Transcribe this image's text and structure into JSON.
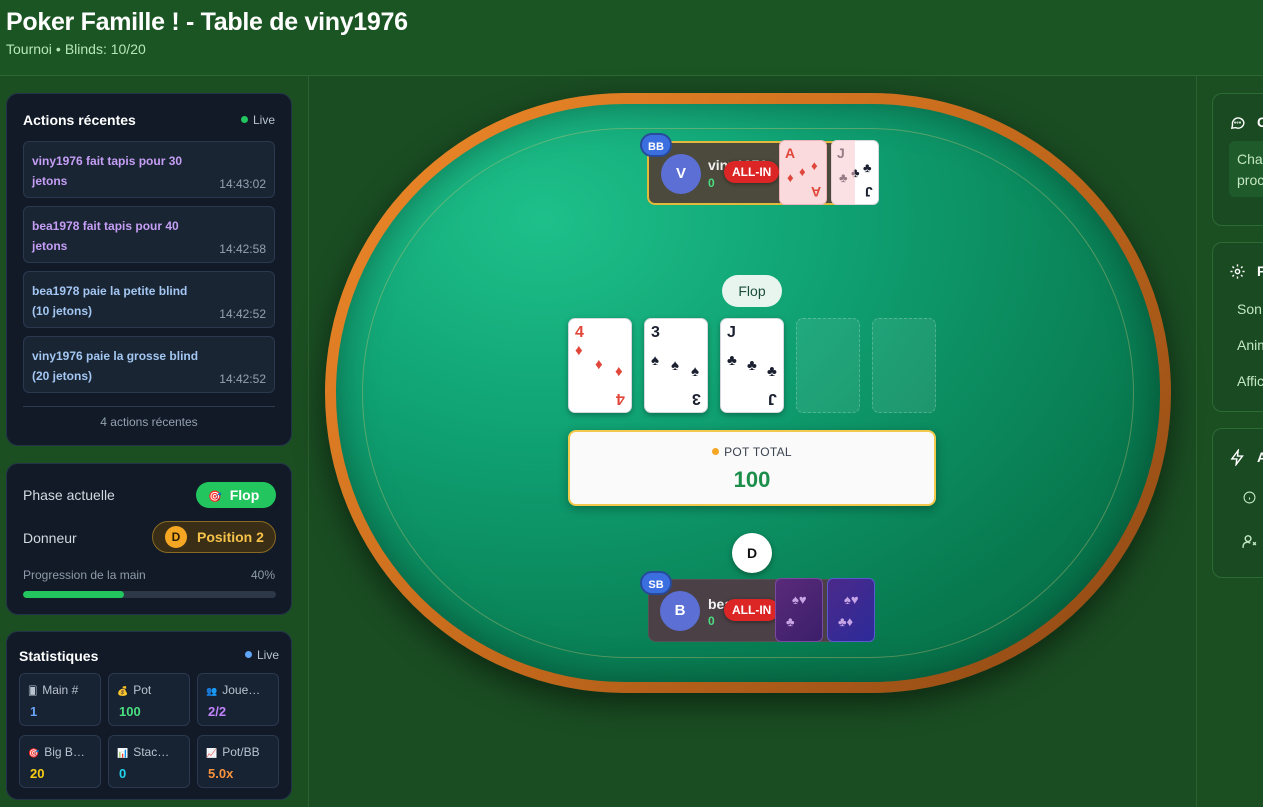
{
  "header": {
    "title": "Poker Famille ! - Table de viny1976",
    "mode": "Tournoi",
    "separator": "•",
    "blinds": "Blinds: 10/20"
  },
  "actions": {
    "title": "Actions récentes",
    "live_label": "Live",
    "items": [
      {
        "text": "viny1976 fait tapis pour 30 jetons",
        "time": "14:43:02"
      },
      {
        "text": "bea1978 fait tapis pour 40 jetons",
        "time": "14:42:58"
      },
      {
        "text": "bea1978 paie la petite blind (10 jetons)",
        "time": "14:42:52"
      },
      {
        "text": "viny1976 paie la grosse blind (20 jetons)",
        "time": "14:42:52"
      }
    ],
    "count_label": "4 actions récentes"
  },
  "phase": {
    "phase_label": "Phase actuelle",
    "phase_value": "Flop",
    "phase_icon": "target-icon",
    "dealer_label": "Donneur",
    "dealer_badge": "D",
    "dealer_value": "Position 2",
    "progress_label": "Progression de la main",
    "progress_text": "40%",
    "progress_fraction": 0.4
  },
  "stats": {
    "title": "Statistiques",
    "live_label": "Live",
    "items": [
      {
        "label": "Main #",
        "value": "1",
        "icon": "card-icon",
        "color": "#6aa5f7"
      },
      {
        "label": "Pot",
        "value": "100",
        "icon": "moneybag-icon",
        "color": "#4ade80"
      },
      {
        "label": "Joue…",
        "value": "2/2",
        "icon": "players-icon",
        "color": "#c084fc"
      },
      {
        "label": "Big B…",
        "value": "20",
        "icon": "target-icon",
        "color": "#facc15"
      },
      {
        "label": "Stac…",
        "value": "0",
        "icon": "chart-icon",
        "color": "#22d3ee"
      },
      {
        "label": "Pot/BB",
        "value": "5.0x",
        "icon": "trend-icon",
        "color": "#fb923c"
      }
    ]
  },
  "table": {
    "phase_label": "Flop",
    "community_cards": [
      {
        "rank": "4",
        "suit": "♦",
        "color": "red"
      },
      {
        "rank": "3",
        "suit": "♠",
        "color": "black"
      },
      {
        "rank": "J",
        "suit": "♣",
        "color": "black"
      }
    ],
    "pot_label": "POT TOTAL",
    "pot_value": "100",
    "dealer_button": "D"
  },
  "players": {
    "top": {
      "role": "BB",
      "initial": "V",
      "name": "viny1976",
      "chips": "0",
      "status": "ALL-IN",
      "cards": [
        {
          "rank": "A",
          "suit": "♦"
        },
        {
          "rank": "J",
          "suit": "♣"
        }
      ]
    },
    "bottom": {
      "role": "SB",
      "initial": "B",
      "name": "bea1978",
      "chips": "0",
      "status": "ALL-IN"
    }
  },
  "right": {
    "chat_title": "C",
    "chat_text_1": "Cha",
    "chat_text_2": "proc",
    "settings_title": "P",
    "settings_items": [
      "Son",
      "Anim",
      "Affic"
    ],
    "actions_title": "A"
  }
}
